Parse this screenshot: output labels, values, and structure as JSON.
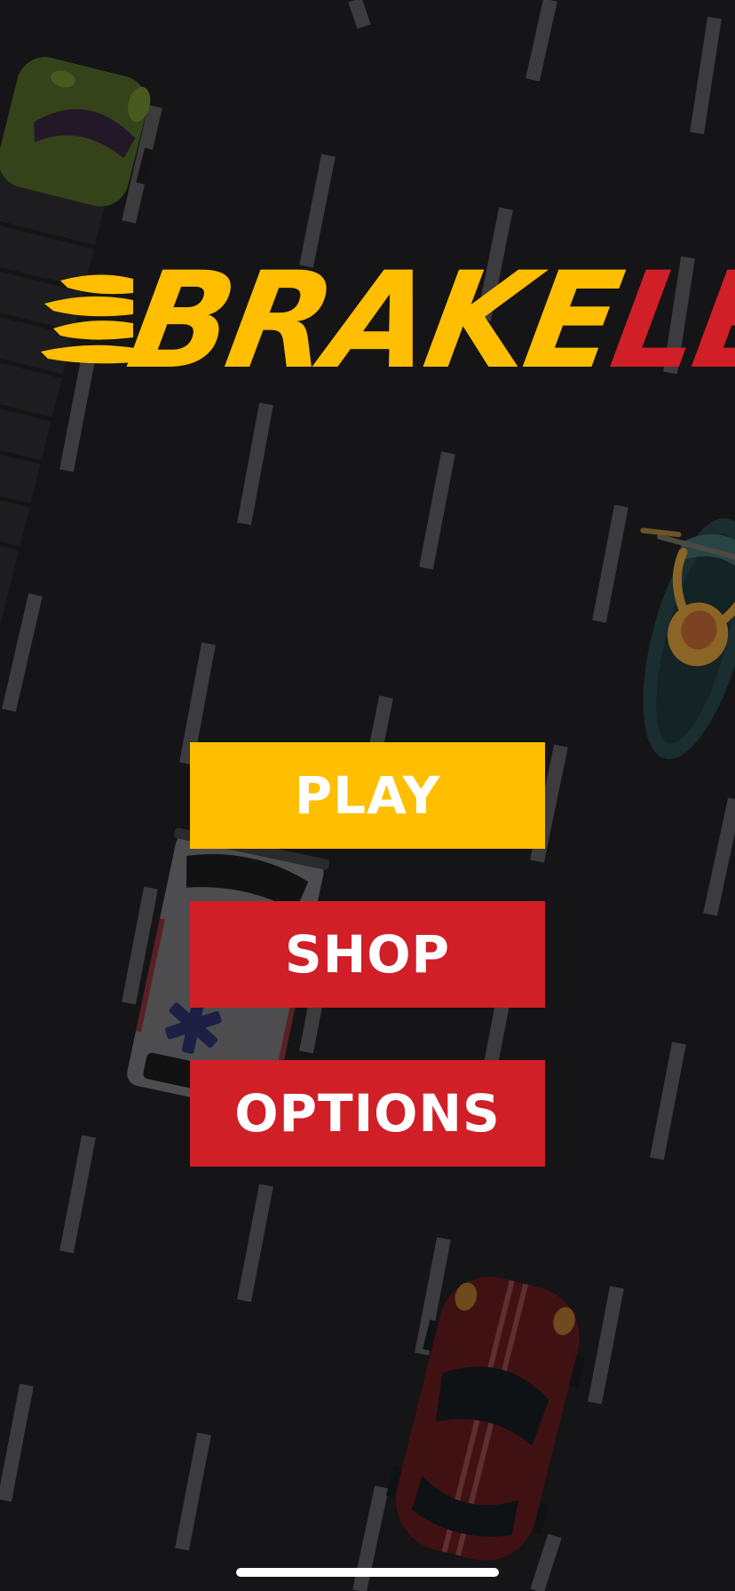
{
  "game": {
    "logo": {
      "part1": "BRAKE",
      "part2": "LESS"
    },
    "menu": {
      "play": "PLAY",
      "shop": "SHOP",
      "options": "OPTIONS"
    },
    "colors": {
      "background": "#151416",
      "lane_marking": "#3c3b3d",
      "logo_yellow": "#ffbe00",
      "logo_red": "#d01f27",
      "play_button": "#ffbe00",
      "secondary_button": "#d01f27",
      "button_text": "#ffffff"
    },
    "vehicles": [
      "green-truck",
      "motorcycle-with-rider",
      "ambulance",
      "red-sports-car"
    ],
    "icons": [
      "flame-icon",
      "star-of-life-icon"
    ]
  }
}
